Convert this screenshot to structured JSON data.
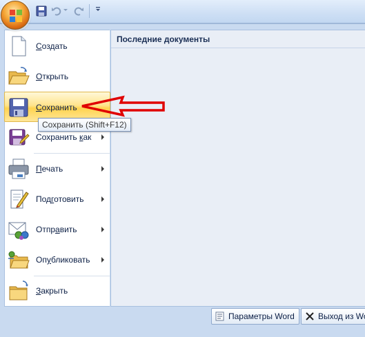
{
  "menu": {
    "items": [
      {
        "label_pre": "",
        "accel": "С",
        "label_post": "оздать",
        "icon": "new-document-icon"
      },
      {
        "label_pre": "",
        "accel": "О",
        "label_post": "ткрыть",
        "icon": "open-folder-icon"
      },
      {
        "label_pre": "",
        "accel": "С",
        "label_post": "охранить",
        "icon": "save-disk-icon"
      },
      {
        "label_pre": "Сохранить ",
        "accel": "к",
        "label_post": "ак",
        "icon": "save-as-icon"
      },
      {
        "label_pre": "",
        "accel": "П",
        "label_post": "ечать",
        "icon": "printer-icon"
      },
      {
        "label_pre": "Под",
        "accel": "г",
        "label_post": "отовить",
        "icon": "prepare-pen-icon"
      },
      {
        "label_pre": "Отпр",
        "accel": "а",
        "label_post": "вить",
        "icon": "send-mail-icon"
      },
      {
        "label_pre": "Оп",
        "accel": "у",
        "label_post": "бликовать",
        "icon": "publish-folder-icon"
      },
      {
        "label_pre": "",
        "accel": "З",
        "label_post": "акрыть",
        "icon": "close-folder-icon"
      }
    ]
  },
  "recent": {
    "title": "Последние документы"
  },
  "tooltip": {
    "text": "Сохранить (Shift+F12)"
  },
  "footer": {
    "options_label": "Параметры Word",
    "exit_label": "Выход из Wo"
  },
  "colors": {
    "highlight": "#ffd34f",
    "annotation_arrow": "#e00000"
  }
}
